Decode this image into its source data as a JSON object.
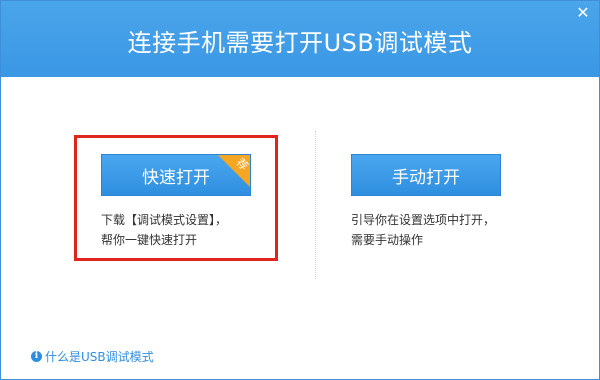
{
  "window": {
    "title": "连接手机需要打开USB调试模式",
    "close_glyph": "✕"
  },
  "quick_open": {
    "button_label": "快速打开",
    "badge_text": "荐",
    "description_line1": "下载【调试模式设置】，",
    "description_line2": "帮你一键快速打开"
  },
  "manual_open": {
    "button_label": "手动打开",
    "description_line1": "引导你在设置选项中打开，",
    "description_line2": "需要手动操作"
  },
  "help": {
    "icon_glyph": "i",
    "link_text": "什么是USB调试模式"
  },
  "colors": {
    "titlebar": "#3a97e4",
    "button": "#3a9be7",
    "badge": "#f5a623",
    "highlight_border": "#e0251e",
    "link": "#2f8ee0"
  },
  "icons": {
    "close": "close-icon",
    "info": "info-icon"
  }
}
